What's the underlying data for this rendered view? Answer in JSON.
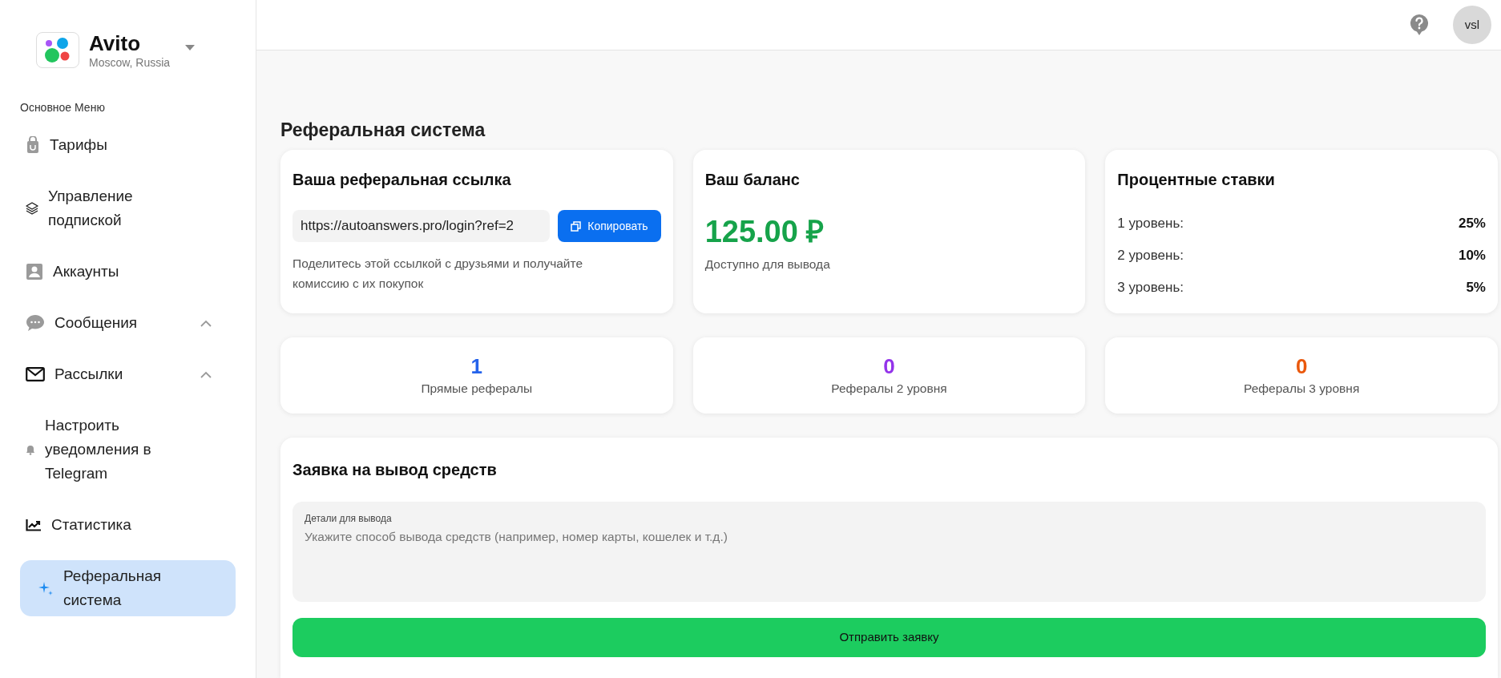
{
  "brand": {
    "name": "Avito",
    "location": "Moscow, Russia"
  },
  "sidebar": {
    "heading": "Основное Меню",
    "items": [
      {
        "kind": "tariffs",
        "label": "Тарифы",
        "selected": false
      },
      {
        "kind": "layers",
        "label": "Управление подпиской",
        "selected": false
      },
      {
        "kind": "accounts",
        "label": "Аккаунты",
        "selected": false
      },
      {
        "kind": "messages",
        "label": "Сообщения",
        "selected": false,
        "expanded": true
      },
      {
        "kind": "mail",
        "label": "Рассылки",
        "selected": false,
        "expanded": true
      },
      {
        "kind": "bell",
        "label": "Настроить уведомления в Telegram",
        "selected": false
      },
      {
        "kind": "stats",
        "label": "Статистика",
        "selected": false
      },
      {
        "kind": "sparkle",
        "label": "Реферальная система",
        "selected": true
      }
    ]
  },
  "header": {
    "avatar": "vsl"
  },
  "page_title": "Реферальная система",
  "link_card": {
    "title": "Ваша реферальная ссылка",
    "link": "https://autoanswers.pro/login?ref=2",
    "copy_button": "Копировать",
    "hint": "Поделитесь этой ссылкой с друзьями и получайте комиссию с их покупок"
  },
  "balance_card": {
    "title": "Ваш баланс",
    "amount": "125.00 ₽",
    "caption": "Доступно для вывода"
  },
  "rates_card": {
    "title": "Процентные ставки",
    "rows": [
      {
        "label": "1 уровень:",
        "value": "25%"
      },
      {
        "label": "2 уровень:",
        "value": "10%"
      },
      {
        "label": "3 уровень:",
        "value": "5%"
      }
    ]
  },
  "stats": [
    {
      "value": "1",
      "label": "Прямые рефералы",
      "color": "#2563eb"
    },
    {
      "value": "0",
      "label": "Рефералы 2 уровня",
      "color": "#9333ea"
    },
    {
      "value": "0",
      "label": "Рефералы 3 уровня",
      "color": "#ea580c"
    }
  ],
  "withdraw": {
    "title": "Заявка на вывод средств",
    "field_label": "Детали для вывода",
    "placeholder": "Укажите способ вывода средств (например, номер карты, кошелек и т.д.)",
    "submit": "Отправить заявку"
  }
}
